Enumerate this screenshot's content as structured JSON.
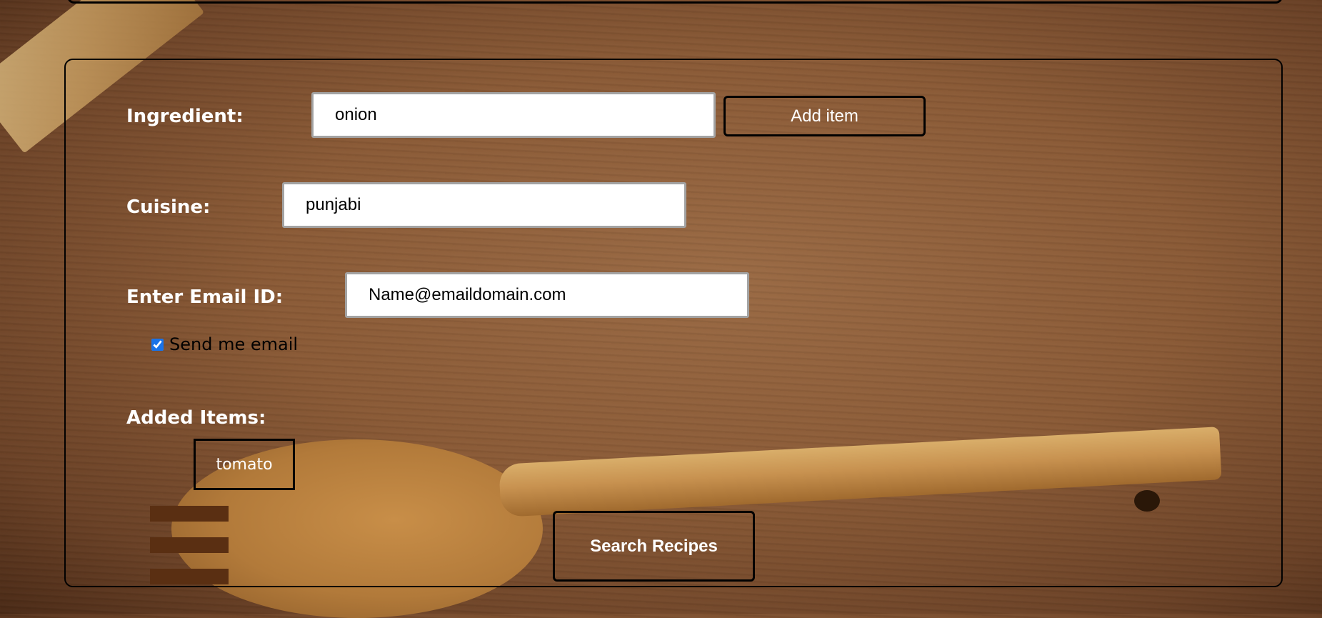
{
  "form": {
    "ingredient_label": "Ingredient:",
    "ingredient_value": "onion",
    "add_item_label": "Add item",
    "cuisine_label": "Cuisine:",
    "cuisine_value": "punjabi",
    "email_label": "Enter Email ID:",
    "email_value": "Name@emaildomain.com",
    "send_email_label": "Send me email",
    "send_email_checked": true,
    "added_items_label": "Added Items:",
    "added_items": [
      "tomato"
    ],
    "search_label": "Search Recipes"
  },
  "colors": {
    "label_text": "#ffffff",
    "checkbox_accent": "#1a73e8",
    "panel_border": "#000000"
  }
}
